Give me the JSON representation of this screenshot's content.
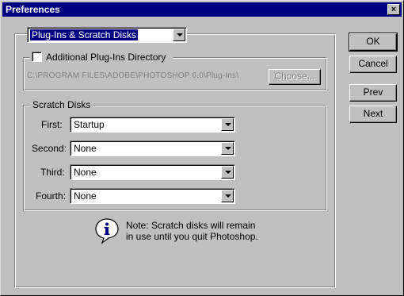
{
  "window": {
    "title": "Preferences",
    "close_symbol": "×"
  },
  "panel_select": {
    "value": "Plug-Ins & Scratch Disks"
  },
  "plugins_group": {
    "checkbox_label": "Additional Plug-Ins Directory",
    "checked": false,
    "path": "C:\\PROGRAM FILES\\ADOBE\\PHOTOSHOP 6.0\\Plug-Ins\\",
    "choose_label": "Choose..."
  },
  "scratch_group": {
    "title": "Scratch Disks",
    "rows": [
      {
        "label": "First:",
        "value": "Startup"
      },
      {
        "label": "Second:",
        "value": "None"
      },
      {
        "label": "Third:",
        "value": "None"
      },
      {
        "label": "Fourth:",
        "value": "None"
      }
    ]
  },
  "note": {
    "line1": "Note: Scratch disks will remain",
    "line2": "in use until you quit Photoshop."
  },
  "buttons": {
    "ok": "OK",
    "cancel": "Cancel",
    "prev": "Prev",
    "next": "Next"
  },
  "colors": {
    "titlebar": "#000080",
    "face": "#c0c0c0",
    "selection": "#000080"
  }
}
